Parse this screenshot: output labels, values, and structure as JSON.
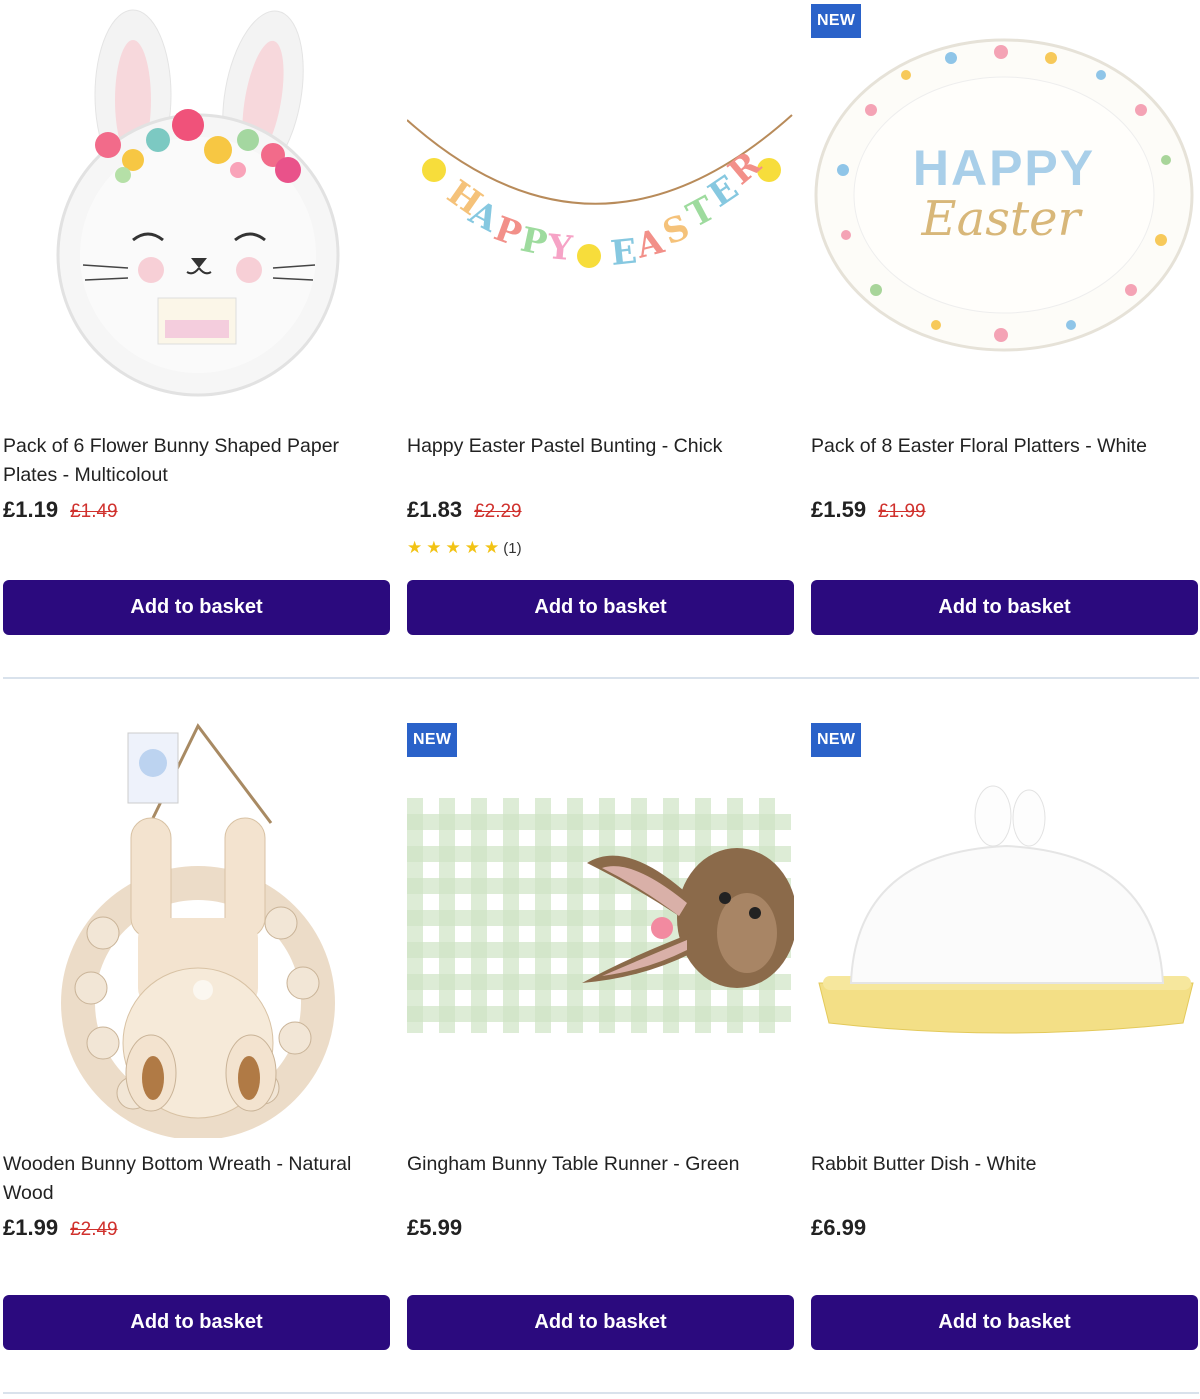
{
  "colors": {
    "button_bg": "#2b0a7e",
    "badge_bg": "#2a62c9",
    "old_price": "#d0312d",
    "star": "#f2c315"
  },
  "products": [
    {
      "title": "Pack of 6 Flower Bunny Shaped Paper Plates - Multicolout",
      "price": "£1.19",
      "old_price": "£1.49",
      "button": "Add to basket",
      "image": "bunny-plates-image"
    },
    {
      "title": "Happy Easter Pastel Bunting - Chick",
      "price": "£1.83",
      "old_price": "£2.29",
      "rating": {
        "stars": 5,
        "count_label": "(1)"
      },
      "button": "Add to basket",
      "image": "easter-bunting-image",
      "image_text": [
        "H",
        "A",
        "P",
        "P",
        "Y",
        "E",
        "A",
        "S",
        "T",
        "E",
        "R"
      ]
    },
    {
      "badge": "NEW",
      "title": "Pack of 8 Easter Floral Platters - White",
      "price": "£1.59",
      "old_price": "£1.99",
      "button": "Add to basket",
      "image": "floral-platter-image",
      "image_text": [
        "HAPPY",
        "Easter"
      ]
    },
    {
      "title": "Wooden Bunny Bottom Wreath - Natural Wood",
      "price": "£1.99",
      "old_price": "£2.49",
      "button": "Add to basket",
      "image": "bunny-wreath-image"
    },
    {
      "badge": "NEW",
      "title": "Gingham Bunny Table Runner - Green",
      "price": "£5.99",
      "button": "Add to basket",
      "image": "table-runner-image"
    },
    {
      "badge": "NEW",
      "title": "Rabbit Butter Dish - White",
      "price": "£6.99",
      "button": "Add to basket",
      "image": "butter-dish-image"
    }
  ]
}
